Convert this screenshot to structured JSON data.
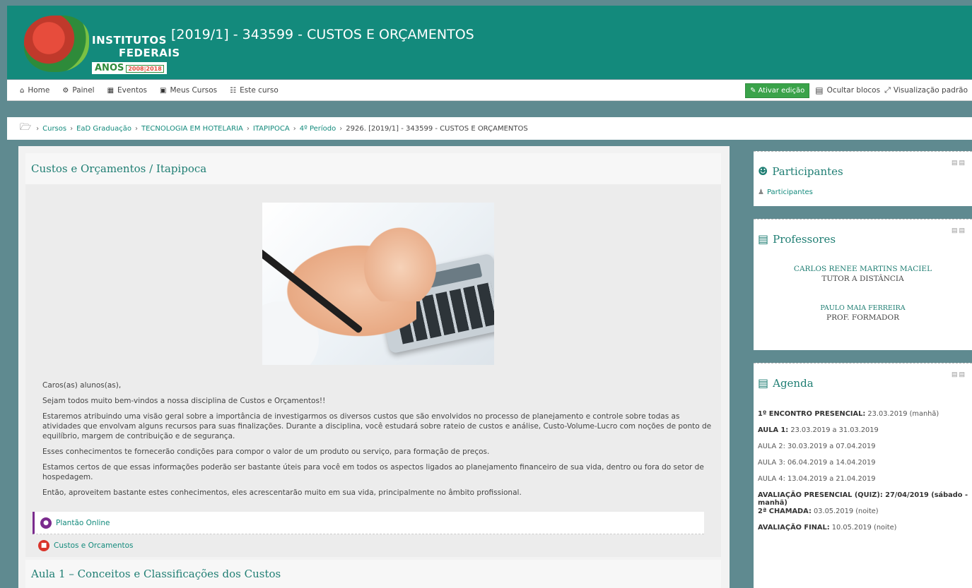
{
  "header": {
    "logo_line1": "INSTITUTOS",
    "logo_line2": "FEDERAIS",
    "logo_anos": "ANOS",
    "logo_years": "2008|2018",
    "course_title": "[2019/1] - 343599 - CUSTOS E ORÇAMENTOS"
  },
  "nav": {
    "items": [
      {
        "label": "Home",
        "icon": "home-icon",
        "glyph": "⌂"
      },
      {
        "label": "Painel",
        "icon": "dashboard-icon",
        "glyph": "⚙"
      },
      {
        "label": "Eventos",
        "icon": "calendar-icon",
        "glyph": "▦"
      },
      {
        "label": "Meus Cursos",
        "icon": "briefcase-icon",
        "glyph": "▣"
      },
      {
        "label": "Este curso",
        "icon": "sitemap-icon",
        "glyph": "☷"
      }
    ],
    "edit_button": "Ativar edição",
    "hide_blocks": "Ocultar blocos",
    "default_view": "Visualização padrão"
  },
  "breadcrumb": {
    "items": [
      "Cursos",
      "EaD Graduação",
      "TECNOLOGIA EM HOTELARIA",
      "ITAPIPOCA",
      "4º Período"
    ],
    "current": "2926. [2019/1] - 343599 - CUSTOS E ORÇAMENTOS"
  },
  "section1": {
    "title": "Custos e Orçamentos / Itapipoca",
    "paragraphs": [
      "Caros(as) alunos(as),",
      "Sejam todos muito bem-vindos a nossa disciplina de Custos e Orçamentos!!",
      "Estaremos atribuindo uma visão geral sobre a importância de investigarmos os diversos custos que são envolvidos no processo de planejamento e controle sobre todas as atividades que envolvam alguns recursos para suas finalizações. Durante a disciplina, você estudará sobre rateio de custos e análise, Custo-Volume-Lucro com noções de ponto de equilíbrio, margem de contribuição e de segurança.",
      "Esses conhecimentos te fornecerão condições para compor o valor de um produto ou serviço, para formação de preços.",
      "Estamos certos de que essas informações poderão ser bastante úteis para você em todos os aspectos ligados ao planejamento financeiro de sua vida, dentro ou fora do setor de hospedagem.",
      "Então, aproveitem bastante estes conhecimentos, eles acrescentarão muito em sua vida, principalmente no âmbito profissional."
    ],
    "activity1": "Plantão Online",
    "activity2": "Custos e Orcamentos"
  },
  "section2": {
    "title": "Aula 1 – Conceitos e Classificações dos Custos"
  },
  "blocks": {
    "participants": {
      "title": "Participantes",
      "link": "Participantes"
    },
    "professors": {
      "title": "Professores",
      "p1_name": "CARLOS RENEE MARTINS MACIEL",
      "p1_role": "TUTOR A DISTÂNCIA",
      "p2_name": "PAULO MAIA FERREIRA",
      "p2_role": "PROF. FORMADOR"
    },
    "agenda": {
      "title": "Agenda",
      "items": [
        {
          "label": "1º ENCONTRO PRESENCIAL:",
          "value": " 23.03.2019 (manhã)",
          "bold": true
        },
        {
          "label": "AULA 1:",
          "value": " 23.03.2019 a 31.03.2019",
          "bold": true
        },
        {
          "label": "",
          "value": "AULA 2: 30.03.2019 a 07.04.2019",
          "bold": false
        },
        {
          "label": "",
          "value": "AULA 3: 06.04.2019 a 14.04.2019",
          "bold": false
        },
        {
          "label": "",
          "value": "AULA 4: 13.04.2019 a 21.04.2019",
          "bold": false
        },
        {
          "label": "AVALIAÇÃO PRESENCIAL (QUIZ): 27/04/2019 (sábado - manhã)",
          "value": "",
          "bold": true
        },
        {
          "label": "2ª CHAMADA:",
          "value": " 03.05.2019 (noite)",
          "bold": true
        },
        {
          "label": "AVALIAÇÃO FINAL:",
          "value": " 10.05.2019 (noite)",
          "bold": true
        }
      ]
    }
  },
  "colors": {
    "brand": "#138a7c",
    "edit_button": "#3aa34a",
    "activity_purple": "#7b2c8e",
    "activity_red": "#d9342b"
  }
}
